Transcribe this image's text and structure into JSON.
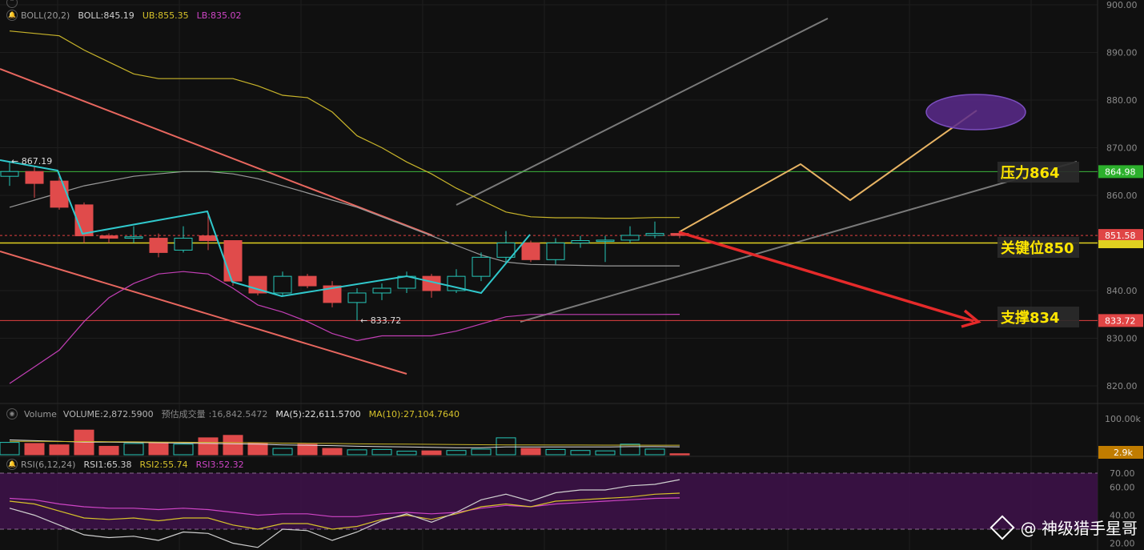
{
  "main_legend": {
    "name": "BOLL(20,2)",
    "boll": "BOLL:845.19",
    "ub": "UB:855.35",
    "lb": "LB:835.02"
  },
  "vol_legend": {
    "name": "Volume",
    "volume": "VOLUME:2,872.5900",
    "est_label": "预估成交量",
    "est_value": ":16,842.5472",
    "ma5": "MA(5):22,611.5700",
    "ma10": "MA(10):27,104.7640"
  },
  "rsi_legend": {
    "name": "RSI(6,12,24)",
    "rsi1": "RSI1:65.38",
    "rsi2": "RSI2:55.74",
    "rsi3": "RSI3:52.32"
  },
  "price_axis": [
    "900.00",
    "890.00",
    "880.00",
    "870.00",
    "860.00",
    "840.00",
    "830.00",
    "820.00"
  ],
  "vol_axis": [
    "100.00k"
  ],
  "rsi_axis": [
    "70.00",
    "60.00",
    "40.00",
    "20.00"
  ],
  "price_tags": [
    {
      "price": 864.98,
      "text": "864.98",
      "bg": "#2cb02c"
    },
    {
      "price": 851.58,
      "text": "851.58",
      "bg": "#e04545"
    },
    {
      "price": 833.72,
      "text": "833.72",
      "bg": "#e04545"
    }
  ],
  "vol_tag": {
    "text": "2.9k",
    "bg": "#c07c00"
  },
  "annotations": {
    "high": "867.19",
    "low": "833.72",
    "resistance": "压力864",
    "key": "关键位850",
    "support": "支撑834"
  },
  "watermark": "@ 神级猎手星哥",
  "colors": {
    "up": "#26c6b8",
    "down": "#e04b4b",
    "ub": "#c8b42a",
    "mid": "#9a9a9a",
    "lb": "#c23fb5",
    "rsi1": "#cfcfcf",
    "rsi2": "#d6c22a",
    "rsi3": "#cf45c6",
    "green_line": "#3bb53b",
    "red_line": "#e34040",
    "yellow_line": "#e0d020",
    "trend": "#e8675f",
    "zigzag": "#30c8cc",
    "forecast": "#e8b464",
    "arrow": "#e52a2a",
    "ellipse": "#5b2a8c",
    "channel": "#7a7a7a"
  },
  "chart_data": {
    "type": "candlestick",
    "ylim": [
      817,
      902
    ],
    "candles": [
      {
        "o": 864.0,
        "h": 867.19,
        "l": 862.0,
        "c": 865.0
      },
      {
        "o": 865.0,
        "h": 866.0,
        "l": 859.5,
        "c": 862.5
      },
      {
        "o": 863.0,
        "h": 864.0,
        "l": 857.0,
        "c": 857.5
      },
      {
        "o": 858.0,
        "h": 858.5,
        "l": 850.0,
        "c": 851.5
      },
      {
        "o": 851.5,
        "h": 852.0,
        "l": 850.0,
        "c": 851.0
      },
      {
        "o": 851.0,
        "h": 853.5,
        "l": 850.0,
        "c": 851.3
      },
      {
        "o": 851.0,
        "h": 852.0,
        "l": 847.0,
        "c": 848.0
      },
      {
        "o": 848.5,
        "h": 853.5,
        "l": 848.0,
        "c": 851.0
      },
      {
        "o": 851.5,
        "h": 856.0,
        "l": 848.5,
        "c": 850.5
      },
      {
        "o": 850.5,
        "h": 850.5,
        "l": 841.0,
        "c": 842.0
      },
      {
        "o": 843.0,
        "h": 843.0,
        "l": 839.0,
        "c": 839.5
      },
      {
        "o": 839.5,
        "h": 844.0,
        "l": 839.0,
        "c": 843.0
      },
      {
        "o": 843.0,
        "h": 843.5,
        "l": 840.5,
        "c": 841.0
      },
      {
        "o": 841.0,
        "h": 842.0,
        "l": 836.5,
        "c": 837.5
      },
      {
        "o": 837.5,
        "h": 840.5,
        "l": 833.72,
        "c": 839.5
      },
      {
        "o": 839.5,
        "h": 841.5,
        "l": 838.0,
        "c": 840.5
      },
      {
        "o": 840.5,
        "h": 844.0,
        "l": 839.5,
        "c": 843.0
      },
      {
        "o": 843.0,
        "h": 843.5,
        "l": 838.5,
        "c": 840.0
      },
      {
        "o": 840.0,
        "h": 844.5,
        "l": 839.5,
        "c": 843.0
      },
      {
        "o": 843.0,
        "h": 848.0,
        "l": 842.0,
        "c": 847.0
      },
      {
        "o": 847.0,
        "h": 852.5,
        "l": 846.0,
        "c": 850.0
      },
      {
        "o": 850.0,
        "h": 850.5,
        "l": 846.0,
        "c": 846.5
      },
      {
        "o": 846.5,
        "h": 851.0,
        "l": 845.5,
        "c": 850.0
      },
      {
        "o": 850.0,
        "h": 851.5,
        "l": 849.0,
        "c": 850.5
      },
      {
        "o": 850.5,
        "h": 851.5,
        "l": 846.0,
        "c": 850.6
      },
      {
        "o": 850.6,
        "h": 853.5,
        "l": 850.0,
        "c": 851.6
      },
      {
        "o": 851.6,
        "h": 854.5,
        "l": 851.0,
        "c": 852.0
      },
      {
        "o": 852.0,
        "h": 852.5,
        "l": 851.0,
        "c": 851.58
      }
    ],
    "boll_ub": [
      894.5,
      894.0,
      893.5,
      890.5,
      888.0,
      885.5,
      884.5,
      884.5,
      884.5,
      884.5,
      883.0,
      881.0,
      880.5,
      877.5,
      872.5,
      870.0,
      867.0,
      864.5,
      861.5,
      859.0,
      856.5,
      855.5,
      855.3,
      855.3,
      855.2,
      855.2,
      855.35,
      855.35
    ],
    "boll_mid": [
      857.5,
      859.0,
      860.5,
      862.0,
      863.0,
      864.0,
      864.5,
      865.0,
      865.0,
      864.5,
      863.5,
      862.0,
      860.5,
      859.0,
      857.5,
      855.5,
      853.5,
      851.5,
      849.5,
      847.5,
      846.0,
      845.5,
      845.4,
      845.3,
      845.2,
      845.2,
      845.2,
      845.19
    ],
    "boll_lb": [
      820.5,
      824.0,
      827.5,
      833.5,
      838.5,
      841.5,
      843.5,
      844.0,
      843.5,
      840.5,
      837.0,
      835.5,
      833.5,
      831.0,
      829.5,
      830.5,
      830.5,
      830.5,
      831.5,
      833.0,
      834.5,
      835.0,
      835.0,
      835.0,
      835.0,
      835.0,
      835.0,
      835.02
    ],
    "volume": [
      {
        "v": 35000,
        "up": true
      },
      {
        "v": 32000,
        "up": false
      },
      {
        "v": 28000,
        "up": false
      },
      {
        "v": 70000,
        "up": false
      },
      {
        "v": 24000,
        "up": false
      },
      {
        "v": 32000,
        "up": true
      },
      {
        "v": 35000,
        "up": false
      },
      {
        "v": 30000,
        "up": true
      },
      {
        "v": 48000,
        "up": false
      },
      {
        "v": 55000,
        "up": false
      },
      {
        "v": 33000,
        "up": false
      },
      {
        "v": 18000,
        "up": true
      },
      {
        "v": 30000,
        "up": false
      },
      {
        "v": 18000,
        "up": false
      },
      {
        "v": 14000,
        "up": true
      },
      {
        "v": 15000,
        "up": true
      },
      {
        "v": 10000,
        "up": true
      },
      {
        "v": 11000,
        "up": false
      },
      {
        "v": 12000,
        "up": true
      },
      {
        "v": 16000,
        "up": true
      },
      {
        "v": 48000,
        "up": true
      },
      {
        "v": 18000,
        "up": false
      },
      {
        "v": 15000,
        "up": true
      },
      {
        "v": 12000,
        "up": true
      },
      {
        "v": 11000,
        "up": true
      },
      {
        "v": 30000,
        "up": true
      },
      {
        "v": 16000,
        "up": true
      },
      {
        "v": 2872.59,
        "up": false
      }
    ],
    "vol_ma5": [
      42000,
      40000,
      38000,
      36000,
      36000,
      35000,
      34000,
      33000,
      32000,
      31000,
      30000,
      28000,
      27000,
      26000,
      24000,
      23000,
      22000,
      21000,
      20000,
      20000,
      22000,
      22000,
      22000,
      22000,
      22000,
      23000,
      23000,
      22611.57
    ],
    "vol_ma10": [
      38000,
      38000,
      37500,
      37500,
      37000,
      36500,
      36000,
      35500,
      35000,
      34500,
      34000,
      33000,
      32500,
      32000,
      31000,
      30500,
      30000,
      29500,
      29000,
      28500,
      28000,
      27800,
      27600,
      27400,
      27300,
      27200,
      27150,
      27104.764
    ],
    "rsi1": [
      45.0,
      40.0,
      33.0,
      26.0,
      24.0,
      25.0,
      22.0,
      28.0,
      27.0,
      20.0,
      17.0,
      30.0,
      29.0,
      22.0,
      28.0,
      36.0,
      41.0,
      35.0,
      42.0,
      51.0,
      55.0,
      50.0,
      56.0,
      58.0,
      58.0,
      61.0,
      62.0,
      65.38
    ],
    "rsi2": [
      50.0,
      48.0,
      43.0,
      38.0,
      37.0,
      38.0,
      36.0,
      38.0,
      38.0,
      33.0,
      30.0,
      34.0,
      34.0,
      30.0,
      32.0,
      37.0,
      40.0,
      37.0,
      41.0,
      46.0,
      48.0,
      46.0,
      50.0,
      51.0,
      52.0,
      53.0,
      55.0,
      55.74
    ],
    "rsi3": [
      52.0,
      51.0,
      48.0,
      46.0,
      45.0,
      45.0,
      44.0,
      45.0,
      44.0,
      42.0,
      40.0,
      41.0,
      41.0,
      39.0,
      39.0,
      41.0,
      42.0,
      41.0,
      42.0,
      45.0,
      47.0,
      46.0,
      48.0,
      49.0,
      50.0,
      51.0,
      52.0,
      52.32
    ]
  }
}
